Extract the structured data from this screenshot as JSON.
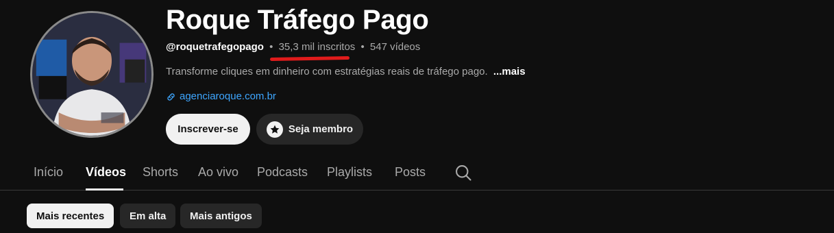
{
  "channel": {
    "name": "Roque Tráfego Pago",
    "handle": "@roquetrafegopago",
    "subscribers": "35,3 mil inscritos",
    "videos": "547 vídeos",
    "separator": "•",
    "description": "Transforme cliques em dinheiro com estratégias reais de tráfego pago.",
    "more_label": "...mais",
    "link": "agenciaroque.com.br",
    "annotation_color": "#e01b1b"
  },
  "actions": {
    "subscribe_label": "Inscrever-se",
    "member_label": "Seja membro"
  },
  "tabs": [
    {
      "label": "Início",
      "active": false
    },
    {
      "label": "Vídeos",
      "active": true
    },
    {
      "label": "Shorts",
      "active": false
    },
    {
      "label": "Ao vivo",
      "active": false
    },
    {
      "label": "Podcasts",
      "active": false
    },
    {
      "label": "Playlists",
      "active": false
    },
    {
      "label": "Posts",
      "active": false
    }
  ],
  "filters": [
    {
      "label": "Mais recentes",
      "active": true
    },
    {
      "label": "Em alta",
      "active": false
    },
    {
      "label": "Mais antigos",
      "active": false
    }
  ],
  "icons": {
    "link": "link-icon",
    "star": "star-icon",
    "search": "search-icon"
  },
  "colors": {
    "background": "#0f0f0f",
    "link": "#3ea6ff",
    "primary_text": "#f1f1f1",
    "secondary_text": "#aaaaaa"
  }
}
